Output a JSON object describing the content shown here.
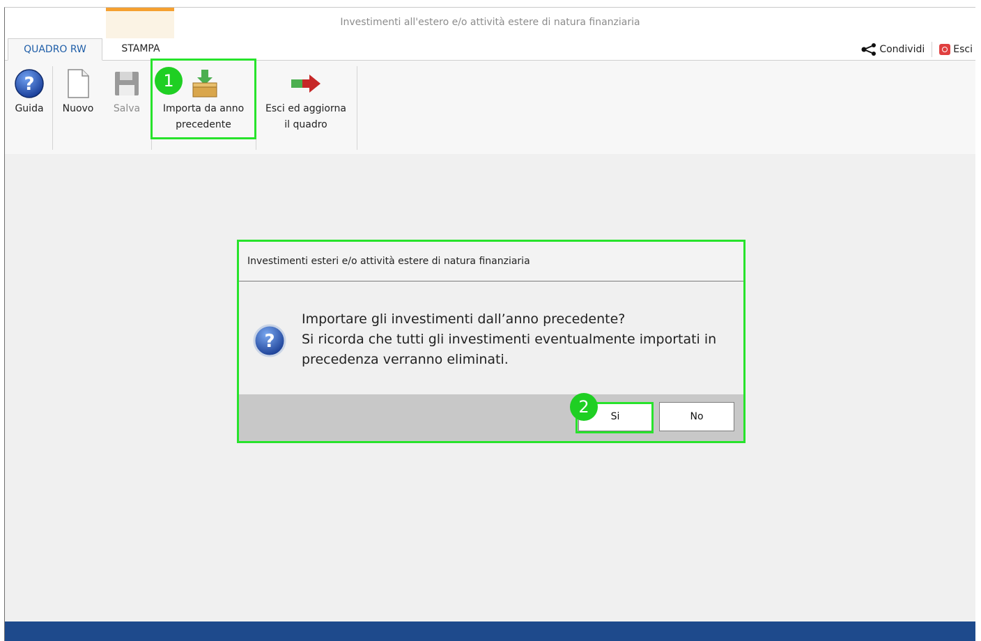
{
  "window": {
    "title": "Investimenti all'estero e/o attività estere di natura finanziaria"
  },
  "tabs": [
    {
      "label": "QUADRO RW"
    },
    {
      "label": "STAMPA"
    }
  ],
  "actions": {
    "share": "Condividi",
    "exit": "Esci"
  },
  "ribbon": {
    "guida": "Guida",
    "nuovo": "Nuovo",
    "salva": "Salva",
    "importa": [
      "Importa da anno",
      "precedente"
    ],
    "esci_aggiorna": [
      "Esci ed aggiorna",
      "il quadro"
    ]
  },
  "dialog": {
    "title": "Investimenti esteri e/o attività estere di natura finanziaria",
    "message": [
      "Importare gli investimenti dall’anno precedente?",
      "Si ricorda che tutti gli investimenti eventualmente importati in",
      "precedenza verranno eliminati."
    ],
    "yes": "Si",
    "no": "No"
  },
  "badges": {
    "step1": "1",
    "step2": "2"
  },
  "colors": {
    "highlight": "#27e32b",
    "accent_tab": "#f5a030",
    "statusbar": "#1e4a8c",
    "active_tab_text": "#1f5ea8"
  }
}
